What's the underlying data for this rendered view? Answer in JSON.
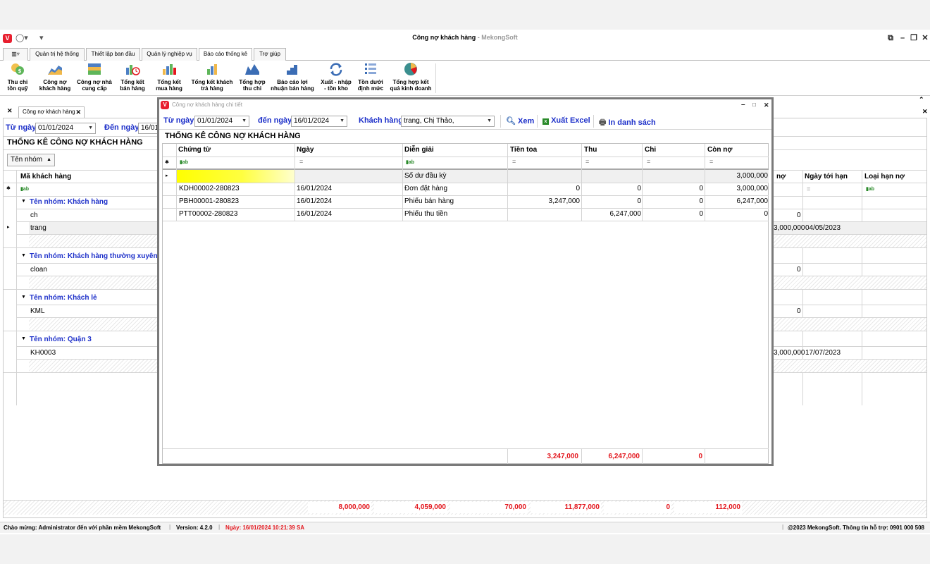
{
  "app": {
    "title": "Công nợ khách hàng",
    "title_sep": " - ",
    "brand": "MekongSoft",
    "logo_letter": "V"
  },
  "ribbon_tabs": [
    {
      "label": "",
      "active": false
    },
    {
      "label": "Quản trị hệ thống",
      "active": false
    },
    {
      "label": "Thiết lập ban đầu",
      "active": false
    },
    {
      "label": "Quản lý nghiệp vụ",
      "active": false
    },
    {
      "label": "Báo cáo thống kê",
      "active": true
    },
    {
      "label": "Trợ giúp",
      "active": false
    }
  ],
  "ribbon_buttons": [
    {
      "line1": "Thu chi",
      "line2": "tồn quỹ",
      "icon": "coins-icon"
    },
    {
      "line1": "Công nợ",
      "line2": "khách hàng",
      "icon": "chart-area-icon"
    },
    {
      "line1": "Công nợ nhà",
      "line2": "cung cấp",
      "icon": "chart-stack-icon"
    },
    {
      "line1": "Tổng kết",
      "line2": "bán hàng",
      "icon": "bar-clock-icon"
    },
    {
      "line1": "Tổng kết",
      "line2": "mua hàng",
      "icon": "bar-chart-icon"
    },
    {
      "line1": "Tổng kết khách",
      "line2": "trả hàng",
      "icon": "bar-arrow-icon"
    },
    {
      "line1": "Tổng hợp",
      "line2": "thu chi",
      "icon": "mountain-chart-icon"
    },
    {
      "line1": "Báo cáo lợi",
      "line2": "nhuận bán hàng",
      "icon": "stair-chart-icon"
    },
    {
      "line1": "Xuất - nhập",
      "line2": "- tồn kho",
      "icon": "refresh-arrow-icon"
    },
    {
      "line1": "Tồn dưới",
      "line2": "định mức",
      "icon": "list-icon"
    },
    {
      "line1": "Tổng hợp kết",
      "line2": "quả kinh doanh",
      "icon": "pie-chart-icon"
    }
  ],
  "doc_tab": {
    "label": "Công nợ khách hàng"
  },
  "bg": {
    "from_label": "Từ ngày",
    "from_value": "01/01/2024",
    "to_label": "Đến ngày",
    "to_value": "16/01/2024",
    "section_title": "THỐNG KÊ CÔNG NỢ KHÁCH HÀNG",
    "group_chip": "Tên nhóm",
    "col_code": "Mã khách hàng",
    "col_debt": "nợ",
    "col_due": "Ngày tới hạn",
    "col_type": "Loại hạn nợ",
    "groups": [
      {
        "title": "Tên nhóm: Khách hàng",
        "rows": [
          {
            "code": "ch",
            "debt": "0",
            "due": ""
          },
          {
            "code": "trang",
            "debt": "3,000,000",
            "due": "04/05/2023"
          }
        ]
      },
      {
        "title": "Tên nhóm: Khách hàng thường xuyên",
        "rows": [
          {
            "code": "cloan",
            "debt": "0",
            "due": ""
          }
        ]
      },
      {
        "title": "Tên nhóm: Khách lẻ",
        "rows": [
          {
            "code": "KML",
            "debt": "0",
            "due": ""
          }
        ]
      },
      {
        "title": "Tên nhóm: Quận 3",
        "rows": [
          {
            "code": "KH0003",
            "debt": "3,000,000",
            "due": "17/07/2023"
          }
        ]
      }
    ],
    "totals": [
      "8,000,000",
      "4,059,000",
      "70,000",
      "11,877,000",
      "0",
      "112,000"
    ]
  },
  "dialog": {
    "title": "Công nợ khách hàng chi tiết",
    "from_label": "Từ ngày",
    "from_value": "01/01/2024",
    "to_label": "đến ngày",
    "to_value": "16/01/2024",
    "customer_label": "Khách hàng",
    "customer_value": "trang, Chị Thảo,",
    "view_label": "Xem",
    "excel_label": "Xuất Excel",
    "print_label": "In danh sách",
    "section_title": "THỐNG KÊ CÔNG NỢ KHÁCH HÀNG",
    "columns": [
      "Chứng từ",
      "Ngày",
      "Diễn giải",
      "Tiền toa",
      "Thu",
      "Chi",
      "Còn nợ"
    ],
    "rows": [
      {
        "doc": "",
        "date": "",
        "desc": "Số dư đầu kỳ",
        "amount": "",
        "thu": "",
        "chi": "",
        "con_no": "3,000,000"
      },
      {
        "doc": "KDH00002-280823",
        "date": "16/01/2024",
        "desc": "Đơn đặt hàng",
        "amount": "0",
        "thu": "0",
        "chi": "0",
        "con_no": "3,000,000"
      },
      {
        "doc": "PBH00001-280823",
        "date": "16/01/2024",
        "desc": "Phiếu bán hàng",
        "amount": "3,247,000",
        "thu": "0",
        "chi": "0",
        "con_no": "6,247,000"
      },
      {
        "doc": "PTT00002-280823",
        "date": "16/01/2024",
        "desc": "Phiếu thu tiền",
        "amount": "",
        "thu": "6,247,000",
        "chi": "0",
        "con_no": "0"
      }
    ],
    "totals": {
      "amount": "3,247,000",
      "thu": "6,247,000",
      "chi": "0"
    }
  },
  "status": {
    "welcome": "Chào mừng: Administrator đến với phần mềm MekongSoft",
    "version": "Version: 4.2.0",
    "date": "Ngày: 16/01/2024 10:21:39 SA",
    "copyright": "@2023 MekongSoft. Thông tin hỗ trợ: 0901 000 508"
  },
  "colors": {
    "accent_blue": "#1c2fc9",
    "total_red": "#e3161d",
    "logo_red": "#e81e2e",
    "highlight_yellow": "#ffff00"
  }
}
